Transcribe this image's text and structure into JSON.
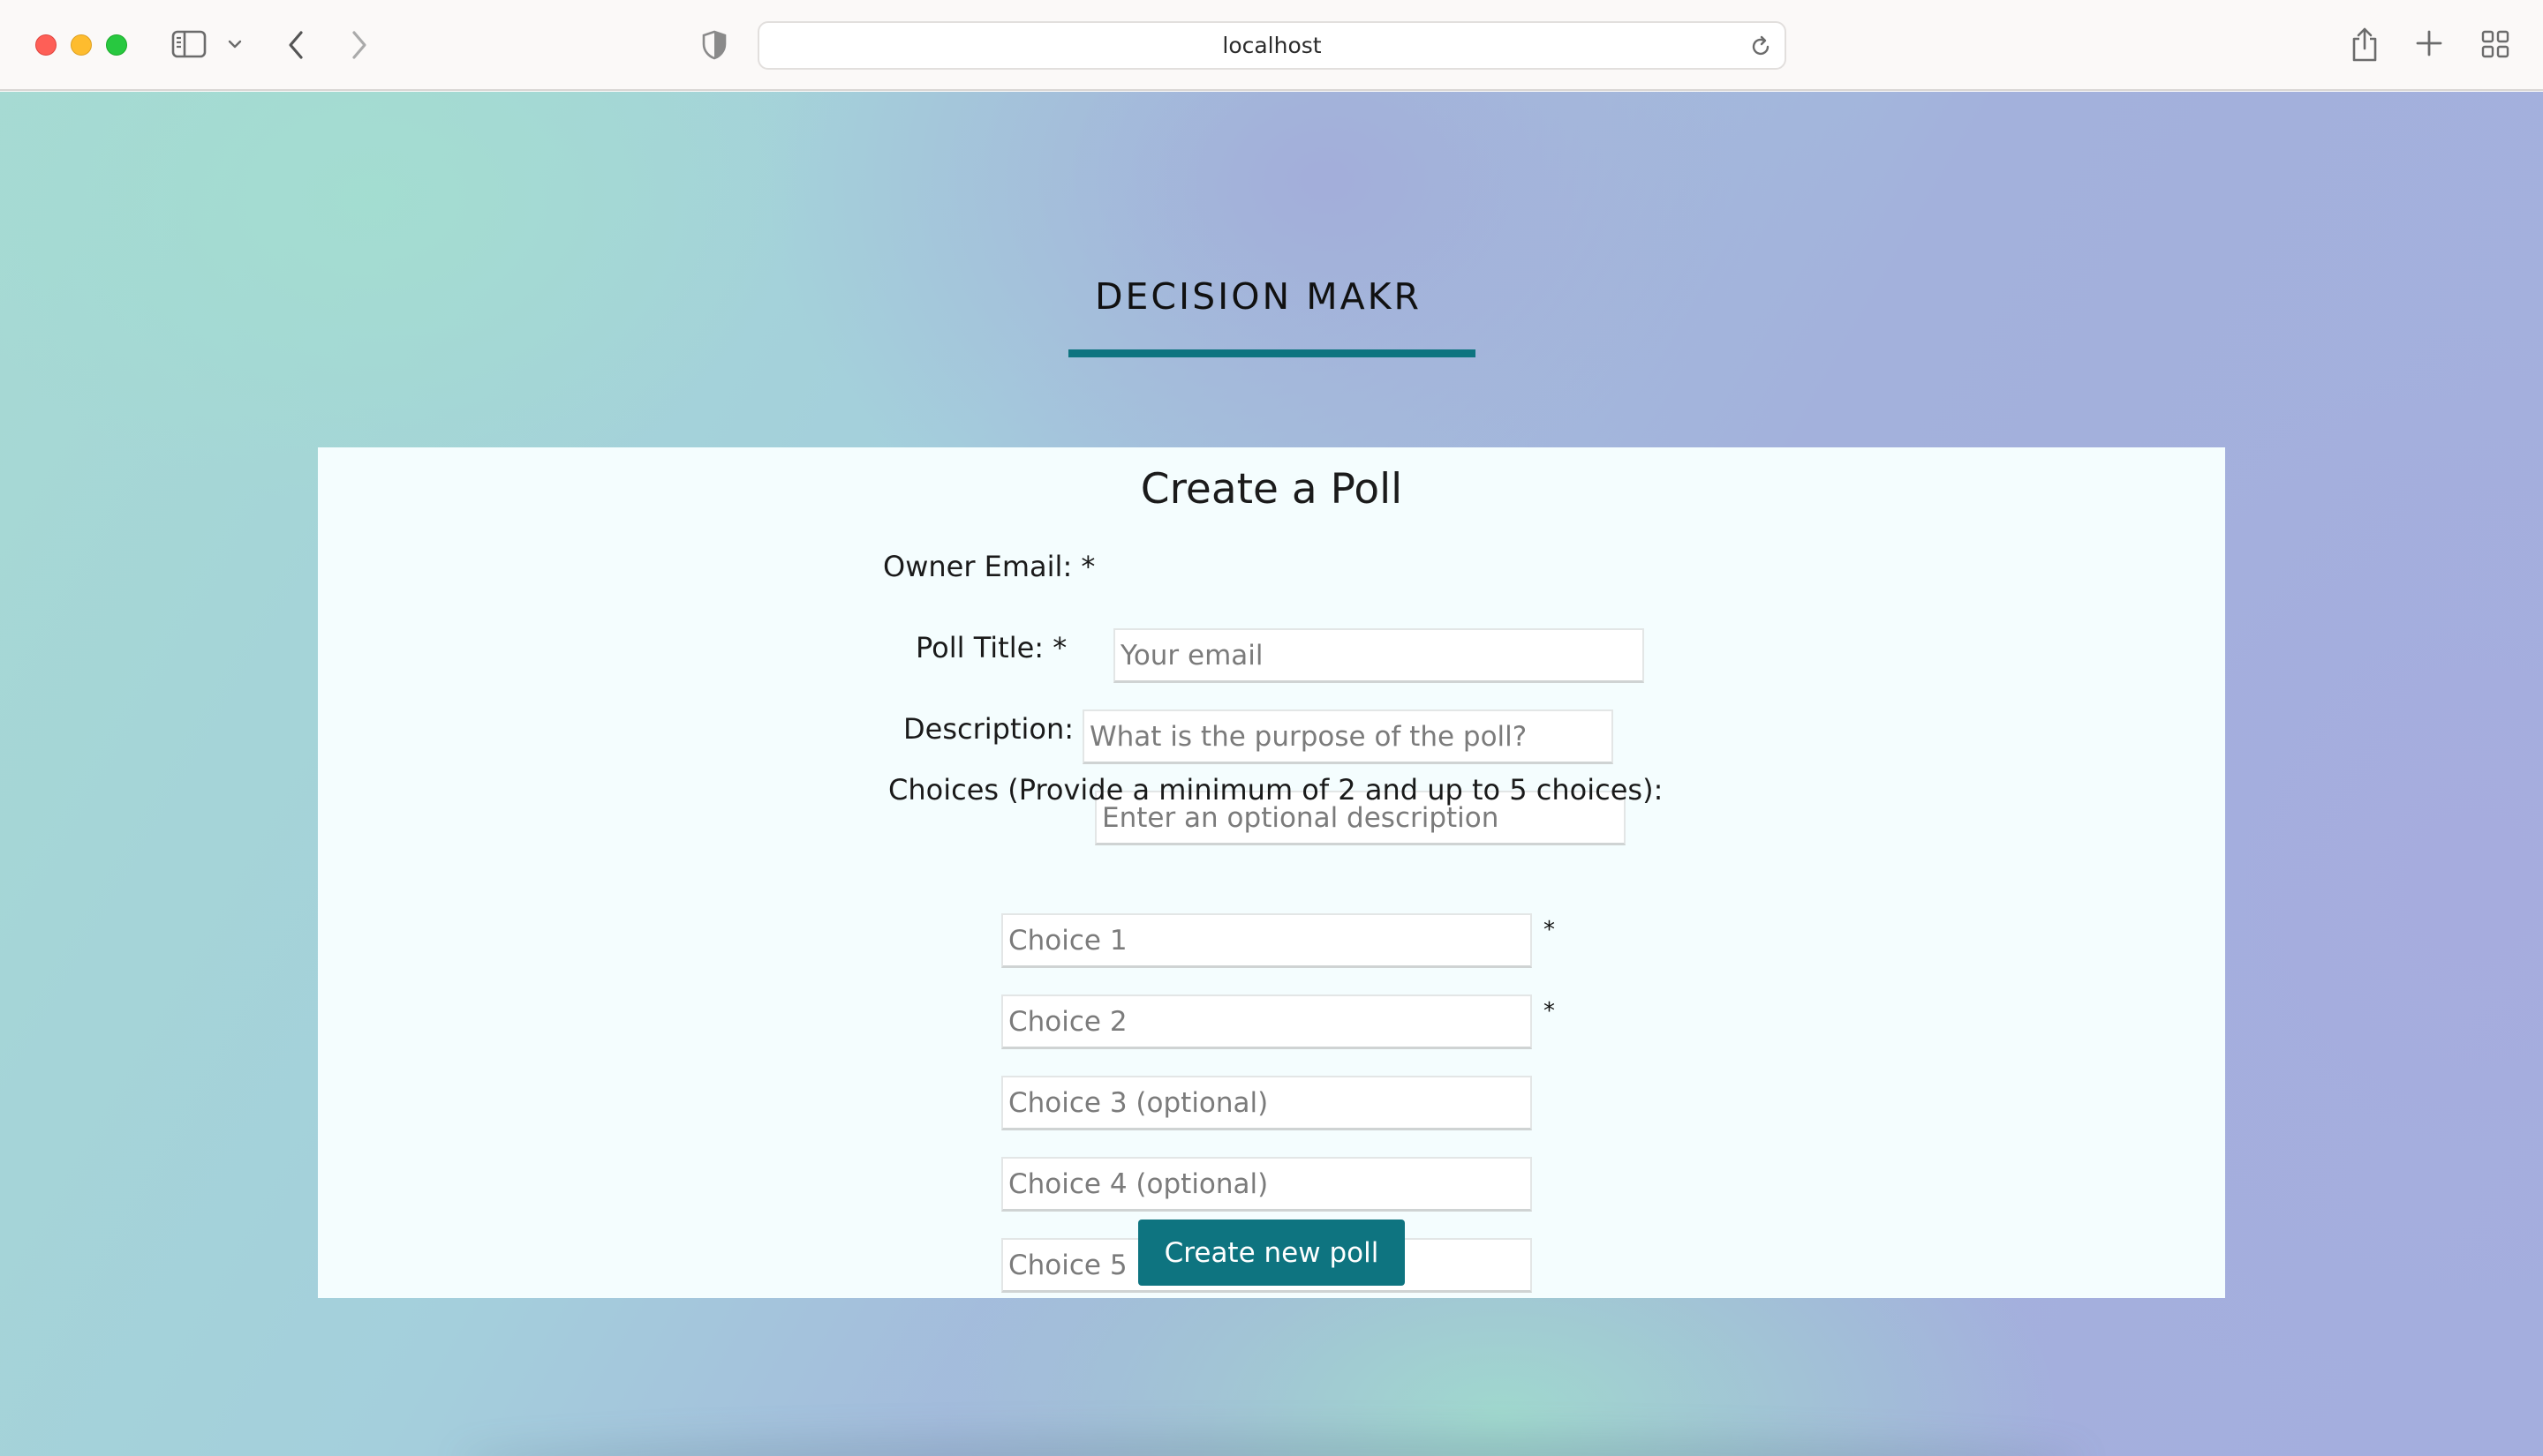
{
  "browser": {
    "url": "localhost"
  },
  "page": {
    "brand": "DECISION MAKR",
    "form": {
      "title": "Create a Poll",
      "owner_email": {
        "label": "Owner Email: *",
        "placeholder": "Your email",
        "value": ""
      },
      "poll_title": {
        "label": "Poll Title: *",
        "placeholder": "What is the purpose of the poll?",
        "value": ""
      },
      "description": {
        "label": "Description:",
        "placeholder": "Enter an optional description",
        "value": ""
      },
      "choices_label": "Choices (Provide a minimum of 2 and up to 5 choices):",
      "choices": [
        {
          "placeholder": "Choice 1",
          "required_mark": "*"
        },
        {
          "placeholder": "Choice 2",
          "required_mark": "*"
        },
        {
          "placeholder": "Choice 3 (optional)",
          "required_mark": ""
        },
        {
          "placeholder": "Choice 4 (optional)",
          "required_mark": ""
        },
        {
          "placeholder": "Choice 5 (optional)",
          "required_mark": ""
        }
      ],
      "submit_label": "Create new poll"
    }
  },
  "colors": {
    "accent": "#0e7480",
    "card_background": "#f4fdfe"
  }
}
